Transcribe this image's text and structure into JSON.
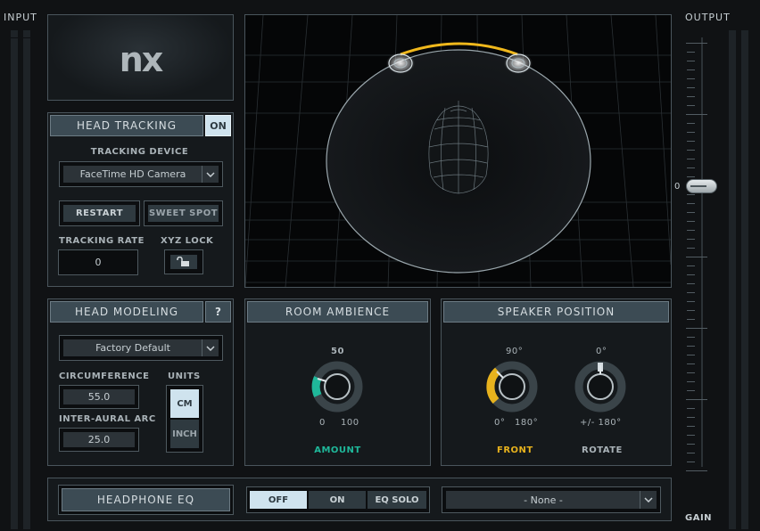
{
  "meters": {
    "input_label": "INPUT",
    "output_label": "OUTPUT",
    "gain_label": "GAIN",
    "gain_value": "0"
  },
  "logo": {
    "text": "nx"
  },
  "head_tracking": {
    "title": "HEAD TRACKING",
    "toggle": "ON",
    "device_label": "TRACKING DEVICE",
    "device_value": "FaceTime HD Camera",
    "restart": "RESTART",
    "sweet_spot": "SWEET SPOT",
    "rate_label": "TRACKING RATE",
    "rate_value": "0",
    "xyz_label": "XYZ LOCK"
  },
  "head_modeling": {
    "title": "HEAD MODELING",
    "help": "?",
    "preset": "Factory Default",
    "circumference_label": "CIRCUMFERENCE",
    "circumference_value": "55.0",
    "interaural_label": "INTER-AURAL ARC",
    "interaural_value": "25.0",
    "units_label": "UNITS",
    "unit_cm": "CM",
    "unit_inch": "INCH",
    "selected_unit": "CM"
  },
  "room_ambience": {
    "title": "ROOM AMBIENCE",
    "value": "50",
    "min": "0",
    "max": "100",
    "knob_label": "AMOUNT",
    "accent": "#1fb89a"
  },
  "speaker_position": {
    "title": "SPEAKER POSITION",
    "front_value": "90°",
    "front_min": "0°",
    "front_max": "180°",
    "front_label": "FRONT",
    "front_accent": "#e7b21d",
    "rotate_value": "0°",
    "rotate_range": "+/- 180°",
    "rotate_label": "ROTATE"
  },
  "headphone_eq": {
    "title": "HEADPHONE EQ",
    "modes": [
      "OFF",
      "ON",
      "EQ SOLO"
    ],
    "selected_mode": "OFF",
    "preset": "- None -"
  },
  "colors": {
    "background": "#101214",
    "panel_header": "#3c4b54",
    "highlight": "#d7e7f0"
  }
}
